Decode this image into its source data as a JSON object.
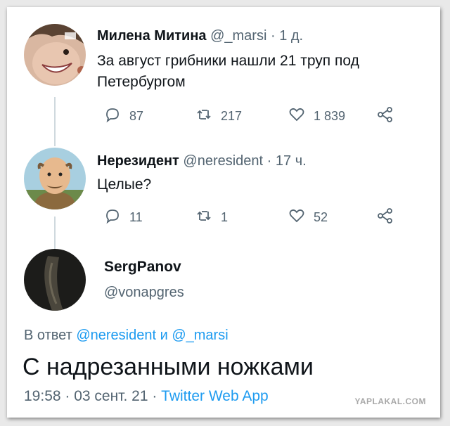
{
  "tweets": [
    {
      "name": "Милена Митина",
      "handle": "@_marsi",
      "time": "1 д.",
      "text_lines": [
        "За август грибники нашли 21 труп под",
        "Петербургом"
      ],
      "replies": "87",
      "retweets": "217",
      "likes": "1 839"
    },
    {
      "name": "Нерезидент",
      "handle": "@neresident",
      "time": "17 ч.",
      "text_lines": [
        "Целые?"
      ],
      "replies": "11",
      "retweets": "1",
      "likes": "52"
    }
  ],
  "main": {
    "name": "SergPanov",
    "handle": "@vonapgres",
    "reply_prefix": "В ответ",
    "reply_mention1": "@neresident",
    "reply_conj": "и",
    "reply_mention2": "@_marsi",
    "text": "С надрезанными ножками",
    "timestamp": "19:58 · 03 сент. 21 · ",
    "source": "Twitter Web App"
  },
  "watermark": "YAPLAKAL.COM",
  "colors": {
    "link": "#1d9bf0",
    "secondary": "#536471",
    "thread_line": "#cfd9de"
  },
  "icons": [
    "reply-icon",
    "retweet-icon",
    "like-icon",
    "share-icon"
  ]
}
